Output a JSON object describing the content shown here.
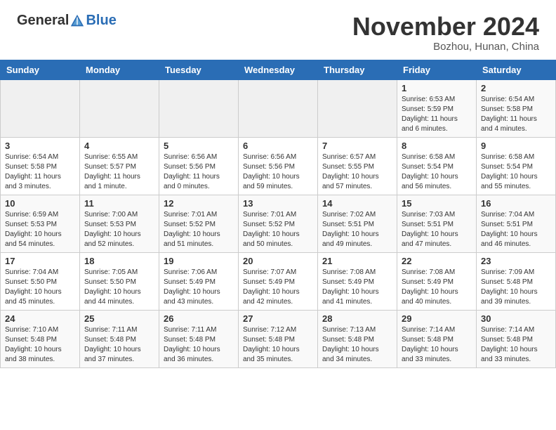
{
  "header": {
    "logo_general": "General",
    "logo_blue": "Blue",
    "month": "November 2024",
    "location": "Bozhou, Hunan, China"
  },
  "weekdays": [
    "Sunday",
    "Monday",
    "Tuesday",
    "Wednesday",
    "Thursday",
    "Friday",
    "Saturday"
  ],
  "weeks": [
    [
      {
        "day": "",
        "info": ""
      },
      {
        "day": "",
        "info": ""
      },
      {
        "day": "",
        "info": ""
      },
      {
        "day": "",
        "info": ""
      },
      {
        "day": "",
        "info": ""
      },
      {
        "day": "1",
        "info": "Sunrise: 6:53 AM\nSunset: 5:59 PM\nDaylight: 11 hours\nand 6 minutes."
      },
      {
        "day": "2",
        "info": "Sunrise: 6:54 AM\nSunset: 5:58 PM\nDaylight: 11 hours\nand 4 minutes."
      }
    ],
    [
      {
        "day": "3",
        "info": "Sunrise: 6:54 AM\nSunset: 5:58 PM\nDaylight: 11 hours\nand 3 minutes."
      },
      {
        "day": "4",
        "info": "Sunrise: 6:55 AM\nSunset: 5:57 PM\nDaylight: 11 hours\nand 1 minute."
      },
      {
        "day": "5",
        "info": "Sunrise: 6:56 AM\nSunset: 5:56 PM\nDaylight: 11 hours\nand 0 minutes."
      },
      {
        "day": "6",
        "info": "Sunrise: 6:56 AM\nSunset: 5:56 PM\nDaylight: 10 hours\nand 59 minutes."
      },
      {
        "day": "7",
        "info": "Sunrise: 6:57 AM\nSunset: 5:55 PM\nDaylight: 10 hours\nand 57 minutes."
      },
      {
        "day": "8",
        "info": "Sunrise: 6:58 AM\nSunset: 5:54 PM\nDaylight: 10 hours\nand 56 minutes."
      },
      {
        "day": "9",
        "info": "Sunrise: 6:58 AM\nSunset: 5:54 PM\nDaylight: 10 hours\nand 55 minutes."
      }
    ],
    [
      {
        "day": "10",
        "info": "Sunrise: 6:59 AM\nSunset: 5:53 PM\nDaylight: 10 hours\nand 54 minutes."
      },
      {
        "day": "11",
        "info": "Sunrise: 7:00 AM\nSunset: 5:53 PM\nDaylight: 10 hours\nand 52 minutes."
      },
      {
        "day": "12",
        "info": "Sunrise: 7:01 AM\nSunset: 5:52 PM\nDaylight: 10 hours\nand 51 minutes."
      },
      {
        "day": "13",
        "info": "Sunrise: 7:01 AM\nSunset: 5:52 PM\nDaylight: 10 hours\nand 50 minutes."
      },
      {
        "day": "14",
        "info": "Sunrise: 7:02 AM\nSunset: 5:51 PM\nDaylight: 10 hours\nand 49 minutes."
      },
      {
        "day": "15",
        "info": "Sunrise: 7:03 AM\nSunset: 5:51 PM\nDaylight: 10 hours\nand 47 minutes."
      },
      {
        "day": "16",
        "info": "Sunrise: 7:04 AM\nSunset: 5:51 PM\nDaylight: 10 hours\nand 46 minutes."
      }
    ],
    [
      {
        "day": "17",
        "info": "Sunrise: 7:04 AM\nSunset: 5:50 PM\nDaylight: 10 hours\nand 45 minutes."
      },
      {
        "day": "18",
        "info": "Sunrise: 7:05 AM\nSunset: 5:50 PM\nDaylight: 10 hours\nand 44 minutes."
      },
      {
        "day": "19",
        "info": "Sunrise: 7:06 AM\nSunset: 5:49 PM\nDaylight: 10 hours\nand 43 minutes."
      },
      {
        "day": "20",
        "info": "Sunrise: 7:07 AM\nSunset: 5:49 PM\nDaylight: 10 hours\nand 42 minutes."
      },
      {
        "day": "21",
        "info": "Sunrise: 7:08 AM\nSunset: 5:49 PM\nDaylight: 10 hours\nand 41 minutes."
      },
      {
        "day": "22",
        "info": "Sunrise: 7:08 AM\nSunset: 5:49 PM\nDaylight: 10 hours\nand 40 minutes."
      },
      {
        "day": "23",
        "info": "Sunrise: 7:09 AM\nSunset: 5:48 PM\nDaylight: 10 hours\nand 39 minutes."
      }
    ],
    [
      {
        "day": "24",
        "info": "Sunrise: 7:10 AM\nSunset: 5:48 PM\nDaylight: 10 hours\nand 38 minutes."
      },
      {
        "day": "25",
        "info": "Sunrise: 7:11 AM\nSunset: 5:48 PM\nDaylight: 10 hours\nand 37 minutes."
      },
      {
        "day": "26",
        "info": "Sunrise: 7:11 AM\nSunset: 5:48 PM\nDaylight: 10 hours\nand 36 minutes."
      },
      {
        "day": "27",
        "info": "Sunrise: 7:12 AM\nSunset: 5:48 PM\nDaylight: 10 hours\nand 35 minutes."
      },
      {
        "day": "28",
        "info": "Sunrise: 7:13 AM\nSunset: 5:48 PM\nDaylight: 10 hours\nand 34 minutes."
      },
      {
        "day": "29",
        "info": "Sunrise: 7:14 AM\nSunset: 5:48 PM\nDaylight: 10 hours\nand 33 minutes."
      },
      {
        "day": "30",
        "info": "Sunrise: 7:14 AM\nSunset: 5:48 PM\nDaylight: 10 hours\nand 33 minutes."
      }
    ]
  ]
}
